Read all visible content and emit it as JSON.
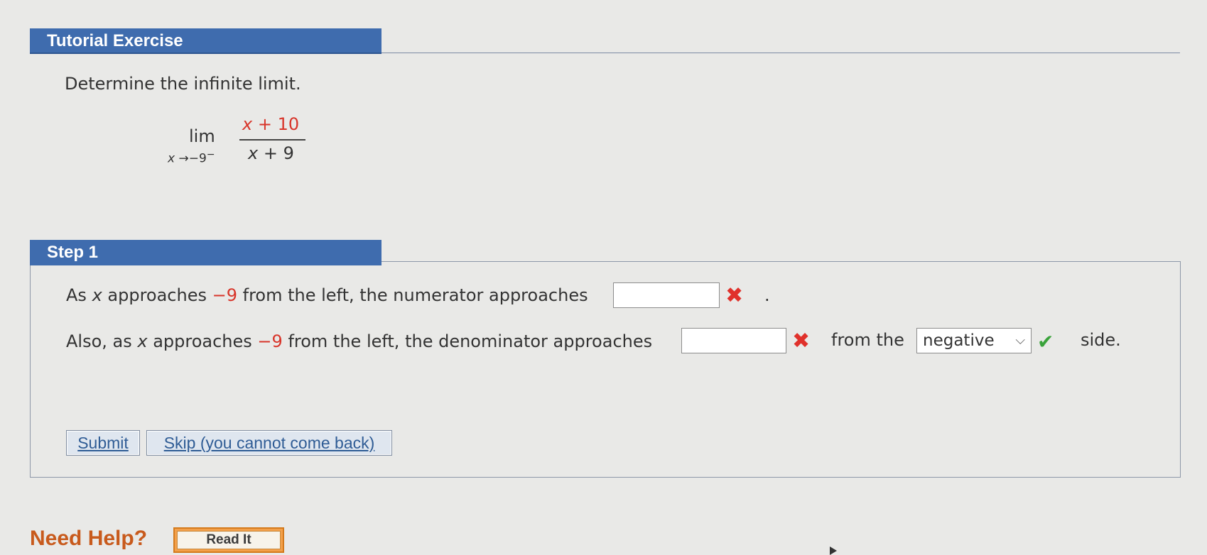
{
  "tutorial": {
    "header": "Tutorial Exercise",
    "question": "Determine the infinite limit.",
    "limit": {
      "lim": "lim",
      "subscript_var": "x",
      "subscript_arrow": "→",
      "subscript_value": "−9",
      "subscript_side": "−",
      "numerator_var": "x",
      "numerator_rest": "+ 10",
      "denominator_var": "x",
      "denominator_rest": "+ 9"
    }
  },
  "step": {
    "header": "Step 1",
    "line1": {
      "part1": "As ",
      "var": "x",
      "part2": " approaches ",
      "value": "−9",
      "part3": " from the left, the numerator approaches",
      "answer": "",
      "status": "incorrect",
      "trailing": "."
    },
    "line2": {
      "part1": "Also, as ",
      "var": "x",
      "part2": " approaches ",
      "value": "−9",
      "part3": " from the left, the denominator approaches",
      "answer": "",
      "status": "incorrect",
      "part4": "from the",
      "select_value": "negative",
      "select_status": "correct",
      "part5": "side."
    },
    "submit_label": "Submit",
    "skip_label": "Skip (you cannot come back)"
  },
  "help": {
    "label": "Need Help?",
    "read_it_label": "Read It"
  },
  "colors": {
    "header_blue": "#3f6cae",
    "incorrect_red": "#e0312b",
    "correct_green": "#3aa33b",
    "highlight_red": "#d8352a"
  }
}
